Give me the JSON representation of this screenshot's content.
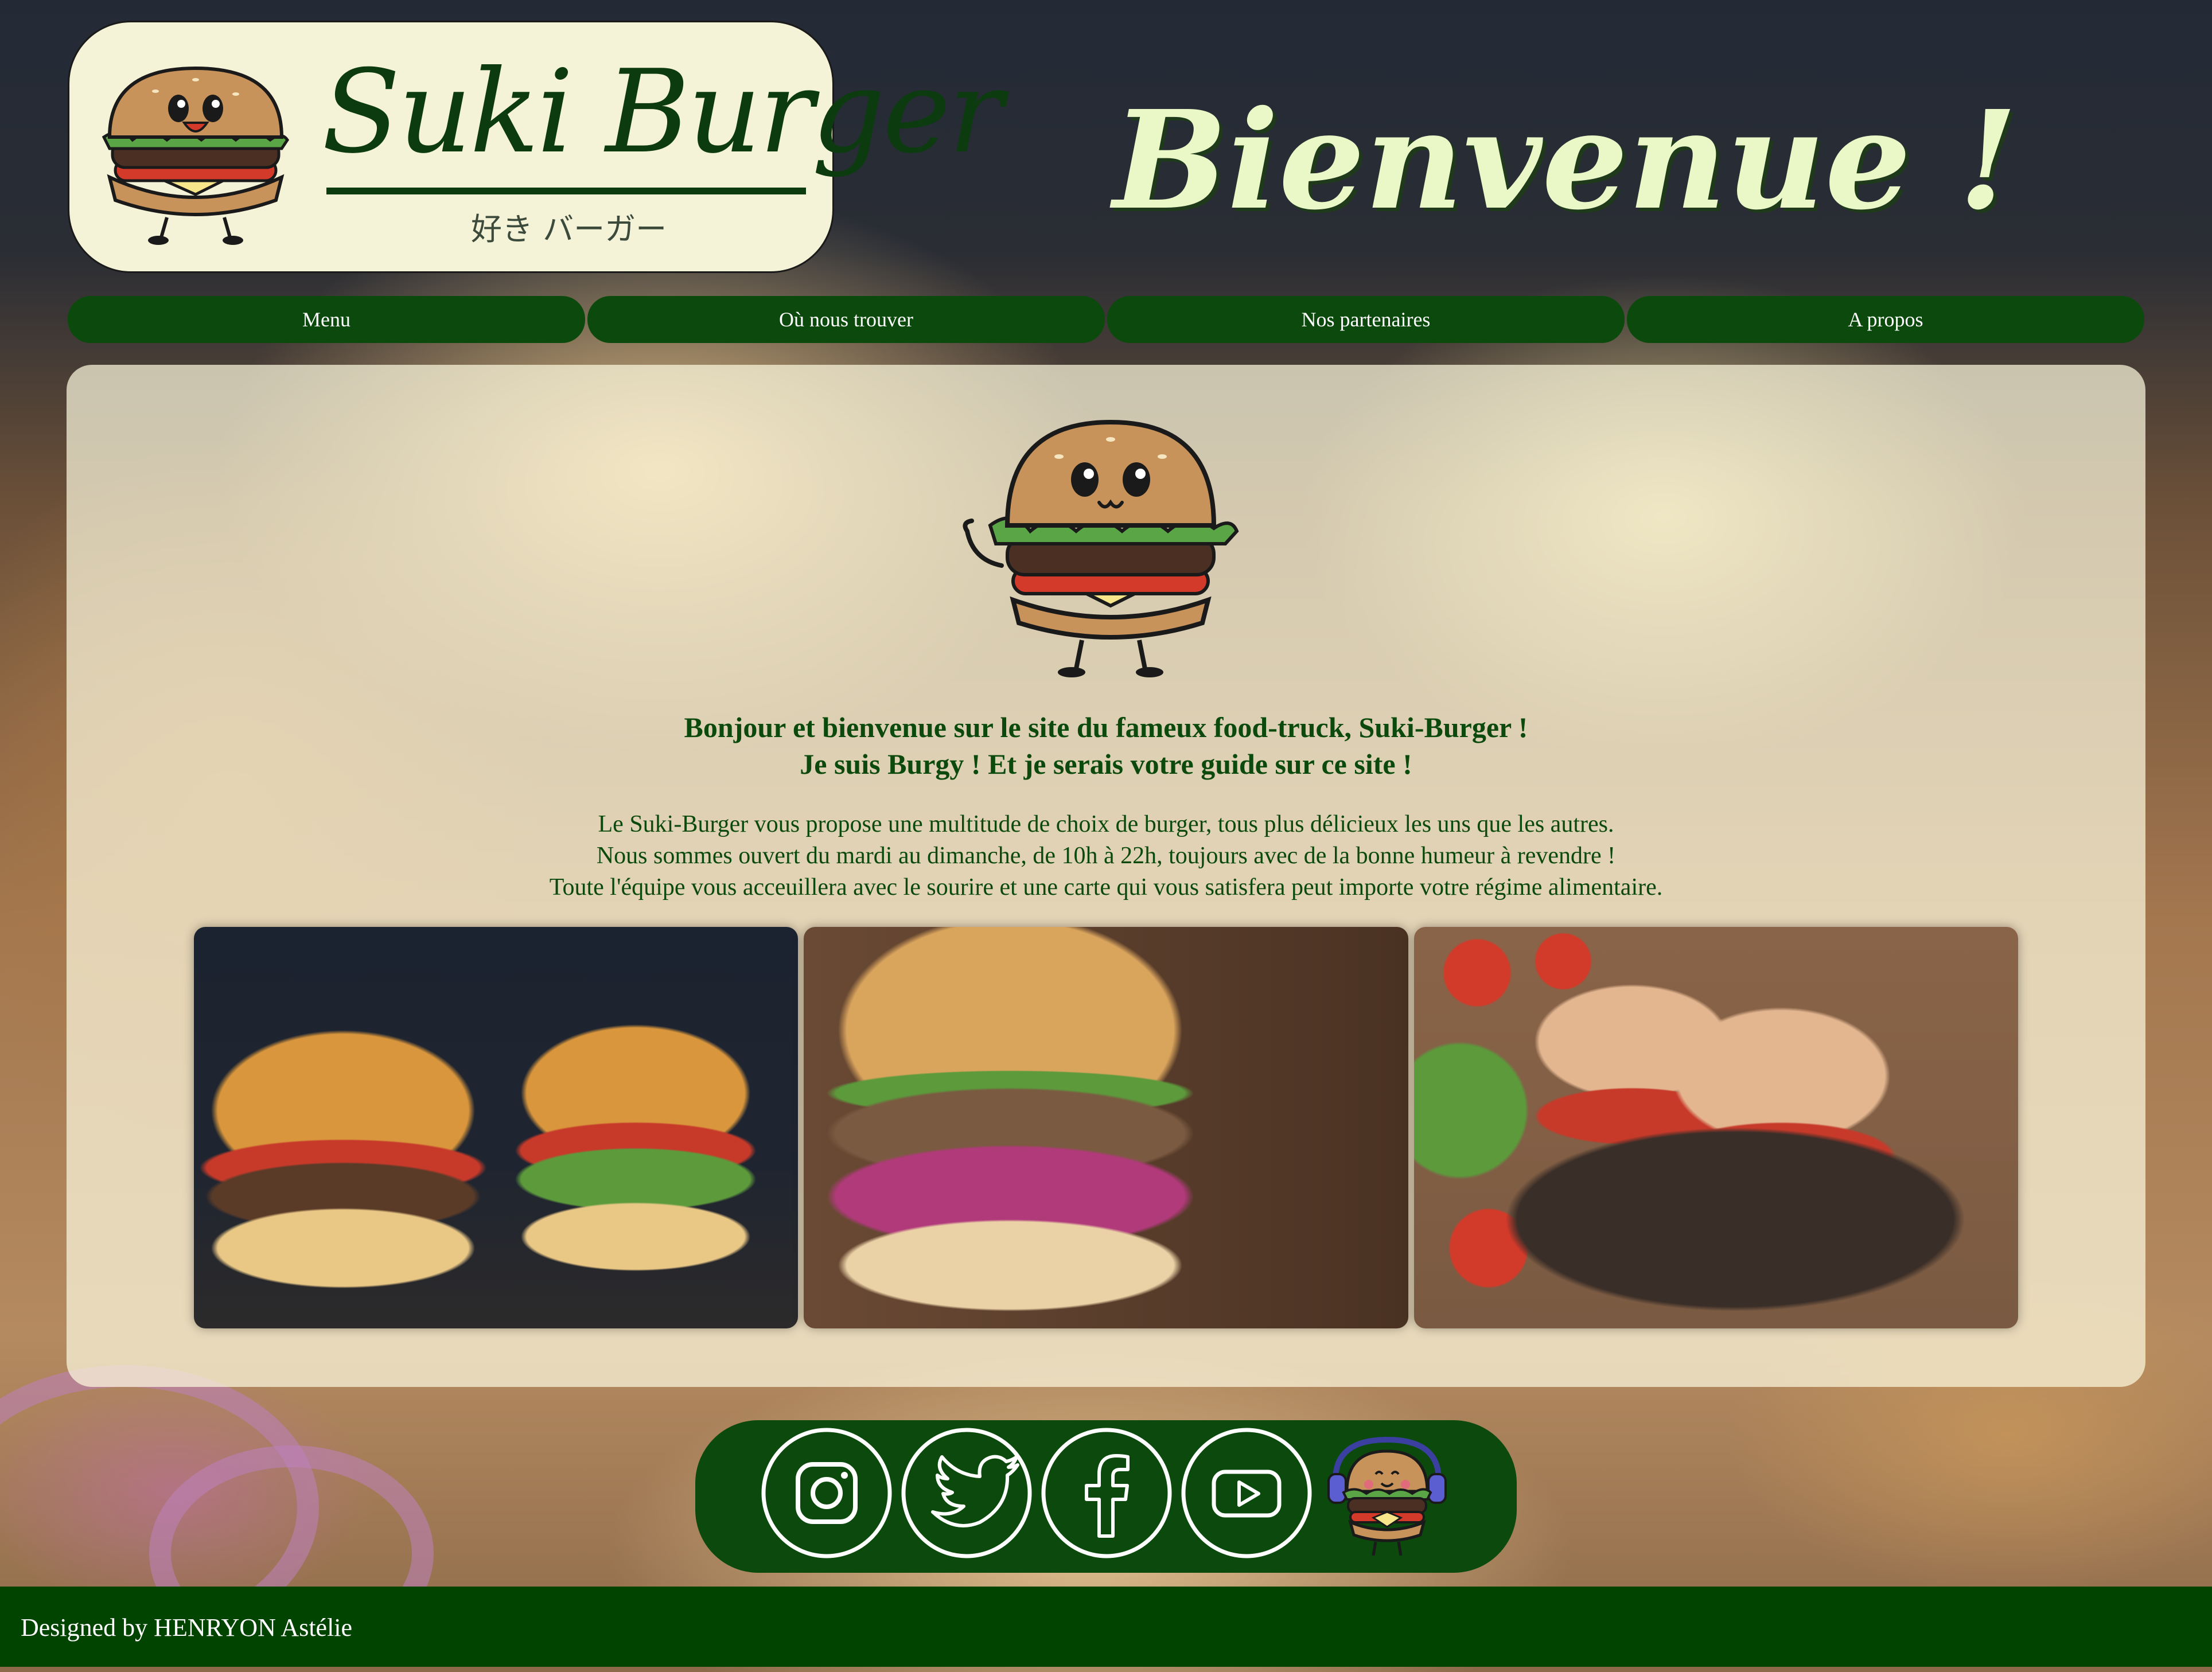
{
  "brand": {
    "name": "Suki Burger",
    "japanese": "好き バーガー"
  },
  "welcome": {
    "title": "Bienvenue !"
  },
  "nav": {
    "items": [
      {
        "label": "Menu"
      },
      {
        "label": "Où nous trouver"
      },
      {
        "label": "Nos partenaires"
      },
      {
        "label": "A propos"
      }
    ]
  },
  "intro": {
    "heading_line1": "Bonjour et bienvenue sur le site du fameux food-truck, Suki-Burger !",
    "heading_line2": "Je suis Burgy ! Et je serais votre guide sur ce site !",
    "line1": "Le Suki-Burger vous propose une multitude de choix de burger, tous plus délicieux les uns que les autres.",
    "line2": "Nous sommes ouvert du mardi au dimanche, de 10h à 22h, toujours avec de la bonne humeur à revendre !",
    "line3": "Toute l'équipe vous acceuillera avec le sourire et une carte qui vous satisfera peut importe votre régime alimentaire."
  },
  "social": {
    "icons": [
      "instagram-icon",
      "twitter-icon",
      "facebook-icon",
      "youtube-icon"
    ]
  },
  "footer": {
    "credit": "Designed by HENRYON Astélie"
  },
  "colors": {
    "brand_green": "#0b4a0c",
    "footer_green": "#004400",
    "cream": "#f5f3d7",
    "title_light": "#eaf8c8"
  }
}
